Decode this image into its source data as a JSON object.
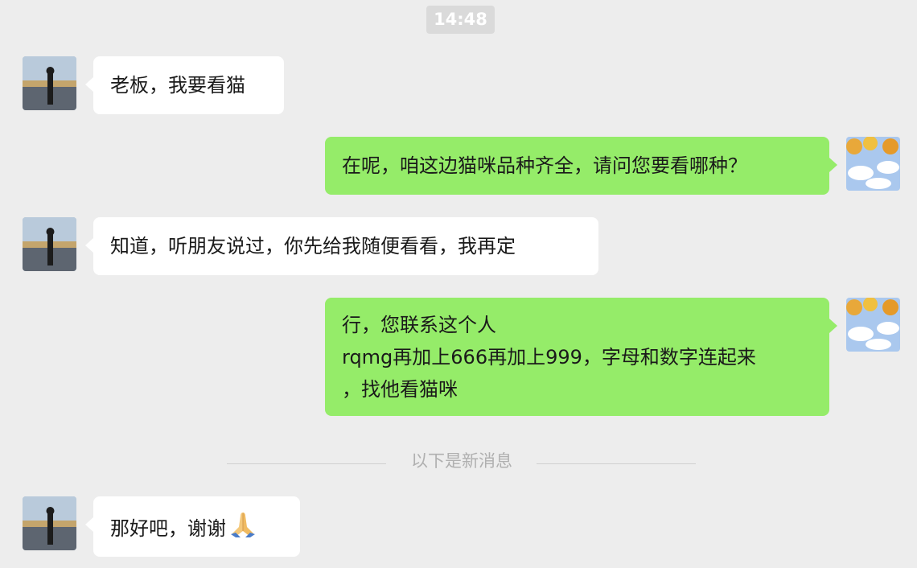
{
  "chat": {
    "timestamp": "14:48",
    "messages": [
      {
        "side": "left",
        "lines": [
          "老板，我要看猫"
        ]
      },
      {
        "side": "right",
        "lines": [
          "在呢，咱这边猫咪品种齐全，请问您要看哪种？"
        ]
      },
      {
        "side": "left",
        "lines": [
          "知道，听朋友说过，你先给我随便看看，我再定"
        ]
      },
      {
        "side": "right",
        "lines": [
          "行，您联系这个人",
          "rqmg再加上666再加上999，字母和数字连起来",
          "，找他看猫咪"
        ]
      },
      {
        "side": "left",
        "lines": [
          "那好吧，谢谢"
        ],
        "emoji": "folded-hands-icon"
      }
    ],
    "new_messages_divider": "以下是新消息"
  },
  "colors": {
    "background": "#ededed",
    "bubble_left": "#ffffff",
    "bubble_right": "#95ec69",
    "timestamp_bg": "#dadada",
    "divider_text": "#b0b0b0"
  }
}
